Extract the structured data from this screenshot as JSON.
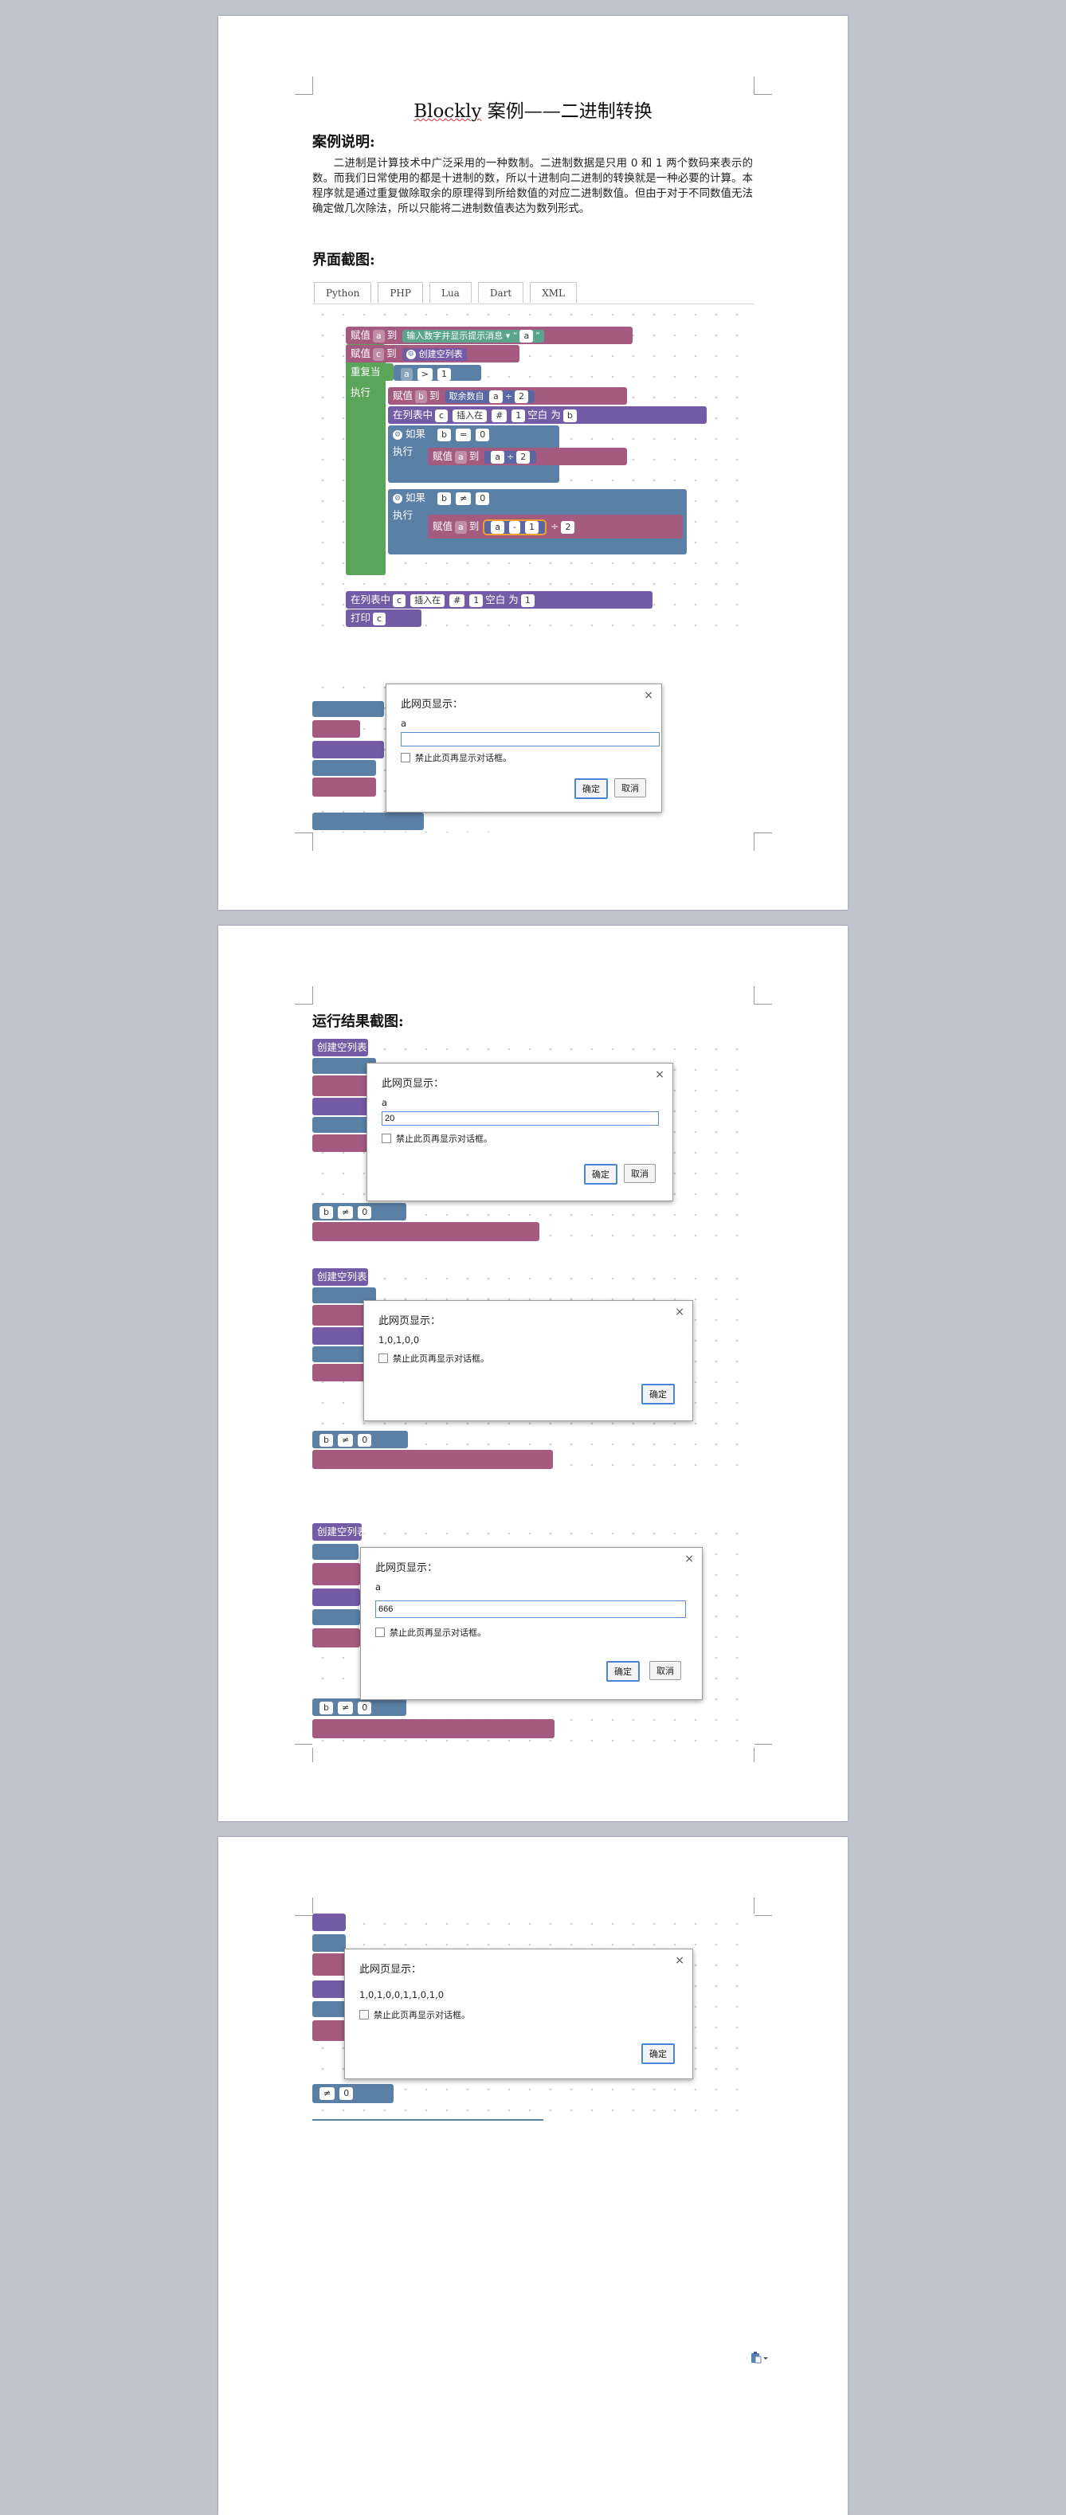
{
  "page1": {
    "title_prefix": "Blockly",
    "title_rest": " 案例——二进制转换",
    "heading_desc": "案例说明:",
    "paragraph": "二进制是计算技术中广泛采用的一种数制。二进制数据是只用 0 和 1 两个数码来表示的数。而我们日常使用的都是十进制的数，所以十进制向二进制的转换就是一种必要的计算。本程序就是通过重复做除取余的原理得到所给数值的对应二进制数值。但由于对于不同数值无法确定做几次除法，所以只能将二进制数值表达为数列形式。",
    "heading_ui": "界面截图:",
    "tabs": [
      "Python",
      "PHP",
      "Lua",
      "Dart",
      "XML"
    ]
  },
  "blocks": {
    "assign": "赋值",
    "to": "到",
    "var_a": "a",
    "var_c": "c",
    "var_b": "b",
    "prompt_text": "输入数字并显示提示消息",
    "quote_open": "“",
    "quote_close": "”",
    "str_a": "a",
    "create_list": "创建空列表",
    "repeat_while": "重复当",
    "op_gt": ">",
    "num_1": "1",
    "num_2": "2",
    "num_0": "0",
    "do": "执行",
    "remainder": "取余数自",
    "div": "÷",
    "in_list": "在列表中",
    "insert_at": "插入在",
    "hash": "#",
    "blank": "空白",
    "as": "为",
    "if": "如果",
    "eq": "=",
    "neq": "≠",
    "minus": "-",
    "print": "打印"
  },
  "dialog1": {
    "title": "此网页显示：",
    "message": "a",
    "input_value": "",
    "checkbox_label": "禁止此页再显示对话框。",
    "ok": "确定",
    "cancel": "取消",
    "close": "×"
  },
  "page2": {
    "heading_result": "运行结果截图:"
  },
  "dialog2": {
    "title": "此网页显示：",
    "message": "a",
    "input_value": "20",
    "checkbox_label": "禁止此页再显示对话框。",
    "ok": "确定",
    "cancel": "取消",
    "close": "×"
  },
  "dialog3": {
    "title": "此网页显示：",
    "message": "1,0,1,0,0",
    "checkbox_label": "禁止此页再显示对话框。",
    "ok": "确定",
    "close": "×"
  },
  "dialog4": {
    "title": "此网页显示：",
    "message": "a",
    "input_value": "666",
    "checkbox_label": "禁止此页再显示对话框。",
    "ok": "确定",
    "cancel": "取消",
    "close": "×"
  },
  "dialog5": {
    "title": "此网页显示：",
    "message": "1,0,1,0,0,1,1,0,1,0",
    "checkbox_label": "禁止此页再显示对话框。",
    "ok": "确定",
    "close": "×"
  },
  "colors": {
    "background": "#c1c4cf",
    "block_variable": "#a55b80",
    "block_list": "#745ba5",
    "block_loop": "#5ba55b",
    "block_logic": "#5b80a5",
    "block_text": "#5ba58c"
  },
  "icons": {
    "paste_options": "clipboard-icon"
  }
}
